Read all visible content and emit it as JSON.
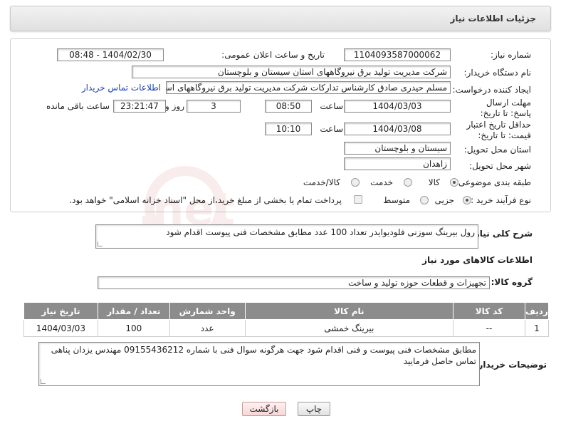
{
  "header": {
    "title": "جزئیات اطلاعات نیاز"
  },
  "form": {
    "need_number": {
      "label": "شماره نیاز:",
      "value": "1104093587000062"
    },
    "announce_datetime": {
      "label": "تاریخ و ساعت اعلان عمومی:",
      "value": "1404/02/30 - 08:48"
    },
    "buyer_org": {
      "label": "نام دستگاه خریدار:",
      "value": "شرکت مدیریت تولید برق نیروگاههای استان سیستان و بلوچستان"
    },
    "creator": {
      "label": "ایجاد کننده درخواست:",
      "value": "مسلم حیدری صادق کارشناس تدارکات شرکت مدیریت تولید برق نیروگاههای استان",
      "contact_link": "اطلاعات تماس خریدار"
    },
    "reply_deadline": {
      "label": "مهلت ارسال پاسخ: تا تاریخ:",
      "date": "1404/03/03",
      "time_label": "ساعت",
      "time": "08:50",
      "days": "3",
      "days_label": "روز و",
      "remaining": "23:21:47",
      "remaining_label": "ساعت باقی مانده"
    },
    "price_validity": {
      "label": "حداقل تاریخ اعتبار قیمت: تا تاریخ:",
      "date": "1404/03/08",
      "time_label": "ساعت",
      "time": "10:10"
    },
    "delivery_province": {
      "label": "استان محل تحویل:",
      "value": "سیستان و بلوچستان"
    },
    "delivery_city": {
      "label": "شهر محل تحویل:",
      "value": "زاهدان"
    },
    "category": {
      "label": "طبقه بندی موضوعی:",
      "options": [
        "کالا",
        "خدمت",
        "کالا/خدمت"
      ],
      "selected": "کالا"
    },
    "purchase_process": {
      "label": "نوع فرآیند خرید :",
      "options": [
        "جزیی",
        "متوسط"
      ],
      "selected": "جزیی",
      "payment_note": "پرداخت تمام یا بخشی از مبلغ خرید،از محل \"اسناد خزانه اسلامی\" خواهد بود."
    }
  },
  "description": {
    "label": "شرح کلی نیاز:",
    "value": "رول بیرینگ سوزنی فلودیوایدر تعداد 100 عدد  مطابق مشخصات فنی پیوست اقدام شود"
  },
  "goods_section": {
    "title": "اطلاعات کالاهای مورد نیاز",
    "group_label": "گروه کالا:",
    "group_value": "تجهیزات و قطعات حوزه تولید و ساخت"
  },
  "items_table": {
    "headers": [
      "ردیف",
      "کد کالا",
      "نام کالا",
      "واحد شمارش",
      "تعداد / مقدار",
      "تاریخ نیاز"
    ],
    "rows": [
      [
        "1",
        "--",
        "بیرینگ خمشی",
        "عدد",
        "100",
        "1404/03/03"
      ]
    ]
  },
  "buyer_notes": {
    "label": "توضیحات خریدار:",
    "value": "مطابق مشخصات فنی پیوست و فنی اقدام شود جهت هرگونه سوال فنی با شماره 09155436212 مهندس یزدان پناهی تماس حاصل فرمایید"
  },
  "buttons": {
    "print": "چاپ",
    "back": "بازگشت"
  },
  "watermark": {
    "text": "AriaTender.net"
  },
  "colors": {
    "table_header": "#8c8c8c",
    "link": "#1a3fb0",
    "back_button": "#f6d6d6"
  }
}
